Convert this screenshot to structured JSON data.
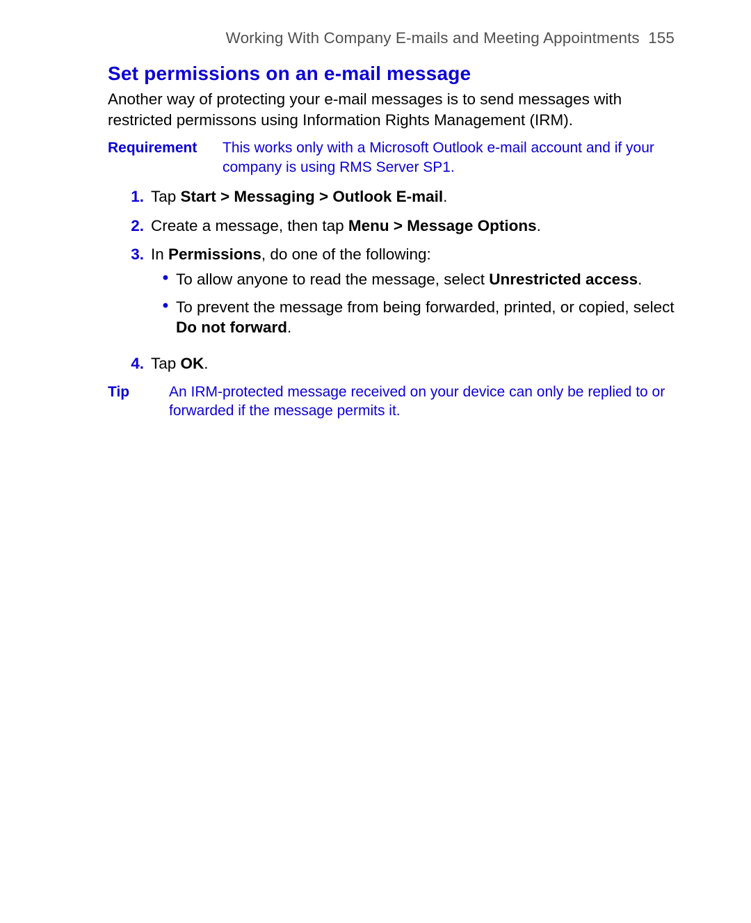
{
  "header": {
    "chapter": "Working With Company E-mails and Meeting Appointments",
    "page_number": "155"
  },
  "title": "Set permissions on an e-mail message",
  "intro": "Another way of protecting your e-mail messages is to send messages with restricted permissons using Information Rights Management (IRM).",
  "requirement": {
    "label": "Requirement",
    "text": "This works only with a Microsoft Outlook e-mail account and if your company is using RMS Server SP1."
  },
  "steps": [
    {
      "num": "1.",
      "pre": "Tap ",
      "bold1": "Start > Messaging > Outlook E-mail",
      "post": "."
    },
    {
      "num": "2.",
      "pre": "Create a message, then tap ",
      "bold1": "Menu > Message Options",
      "post": "."
    },
    {
      "num": "3.",
      "pre": "In ",
      "bold1": "Permissions",
      "post": ", do one of the following:",
      "sub": [
        {
          "pre": "To allow anyone to read the message, select ",
          "bold1": "Unrestricted access",
          "post": "."
        },
        {
          "pre": "To prevent the message from being forwarded, printed, or copied, select ",
          "bold1": "Do not forward",
          "post": "."
        }
      ]
    },
    {
      "num": "4.",
      "pre": "Tap ",
      "bold1": "OK",
      "post": "."
    }
  ],
  "tip": {
    "label": "Tip",
    "text": "An IRM-protected message received on your device can only be replied to or forwarded if the message permits it."
  }
}
